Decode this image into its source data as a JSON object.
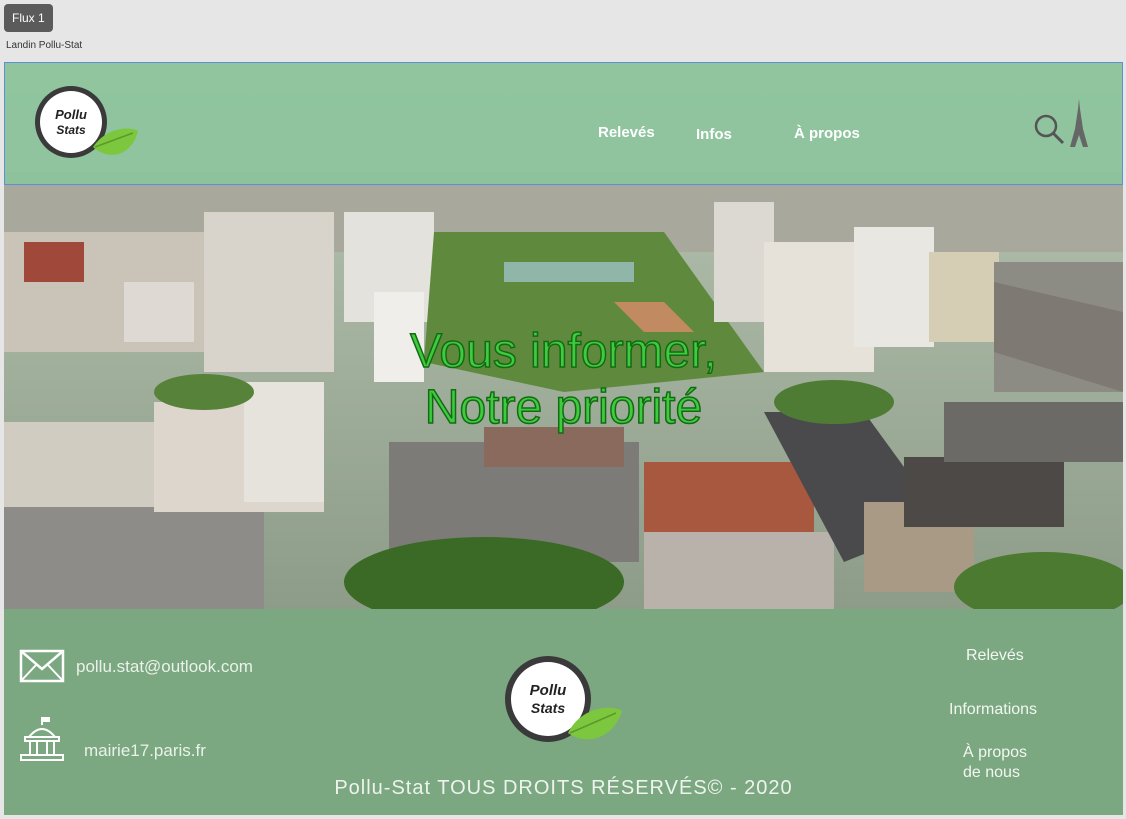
{
  "editor": {
    "flow_label": "Flux 1",
    "frame_name": "Landin Pollu-Stat"
  },
  "brand": {
    "logo_line1": "Pollu",
    "logo_line2": "Stats"
  },
  "nav": {
    "items": [
      "Relevés",
      "Infos",
      "À propos"
    ]
  },
  "hero": {
    "title_line1": "Vous informer,",
    "title_line2": "Notre priorité"
  },
  "footer": {
    "email": "pollu.stat@outlook.com",
    "website": "mairie17.paris.fr",
    "links": [
      "Relevés",
      "Informations",
      "À propos",
      "de nous"
    ],
    "copyright": "Pollu-Stat TOUS DROITS RÉSERVÉS© - 2020"
  },
  "icons": [
    "mail-icon",
    "city-hall-icon",
    "search-icon",
    "eiffel-tower-icon",
    "leaf-icon"
  ],
  "colors": {
    "nav_bg": "#8cc49c",
    "footer_bg": "#7ba880",
    "title_green": "#3ecb3e",
    "leaf": "#7dc73f"
  }
}
